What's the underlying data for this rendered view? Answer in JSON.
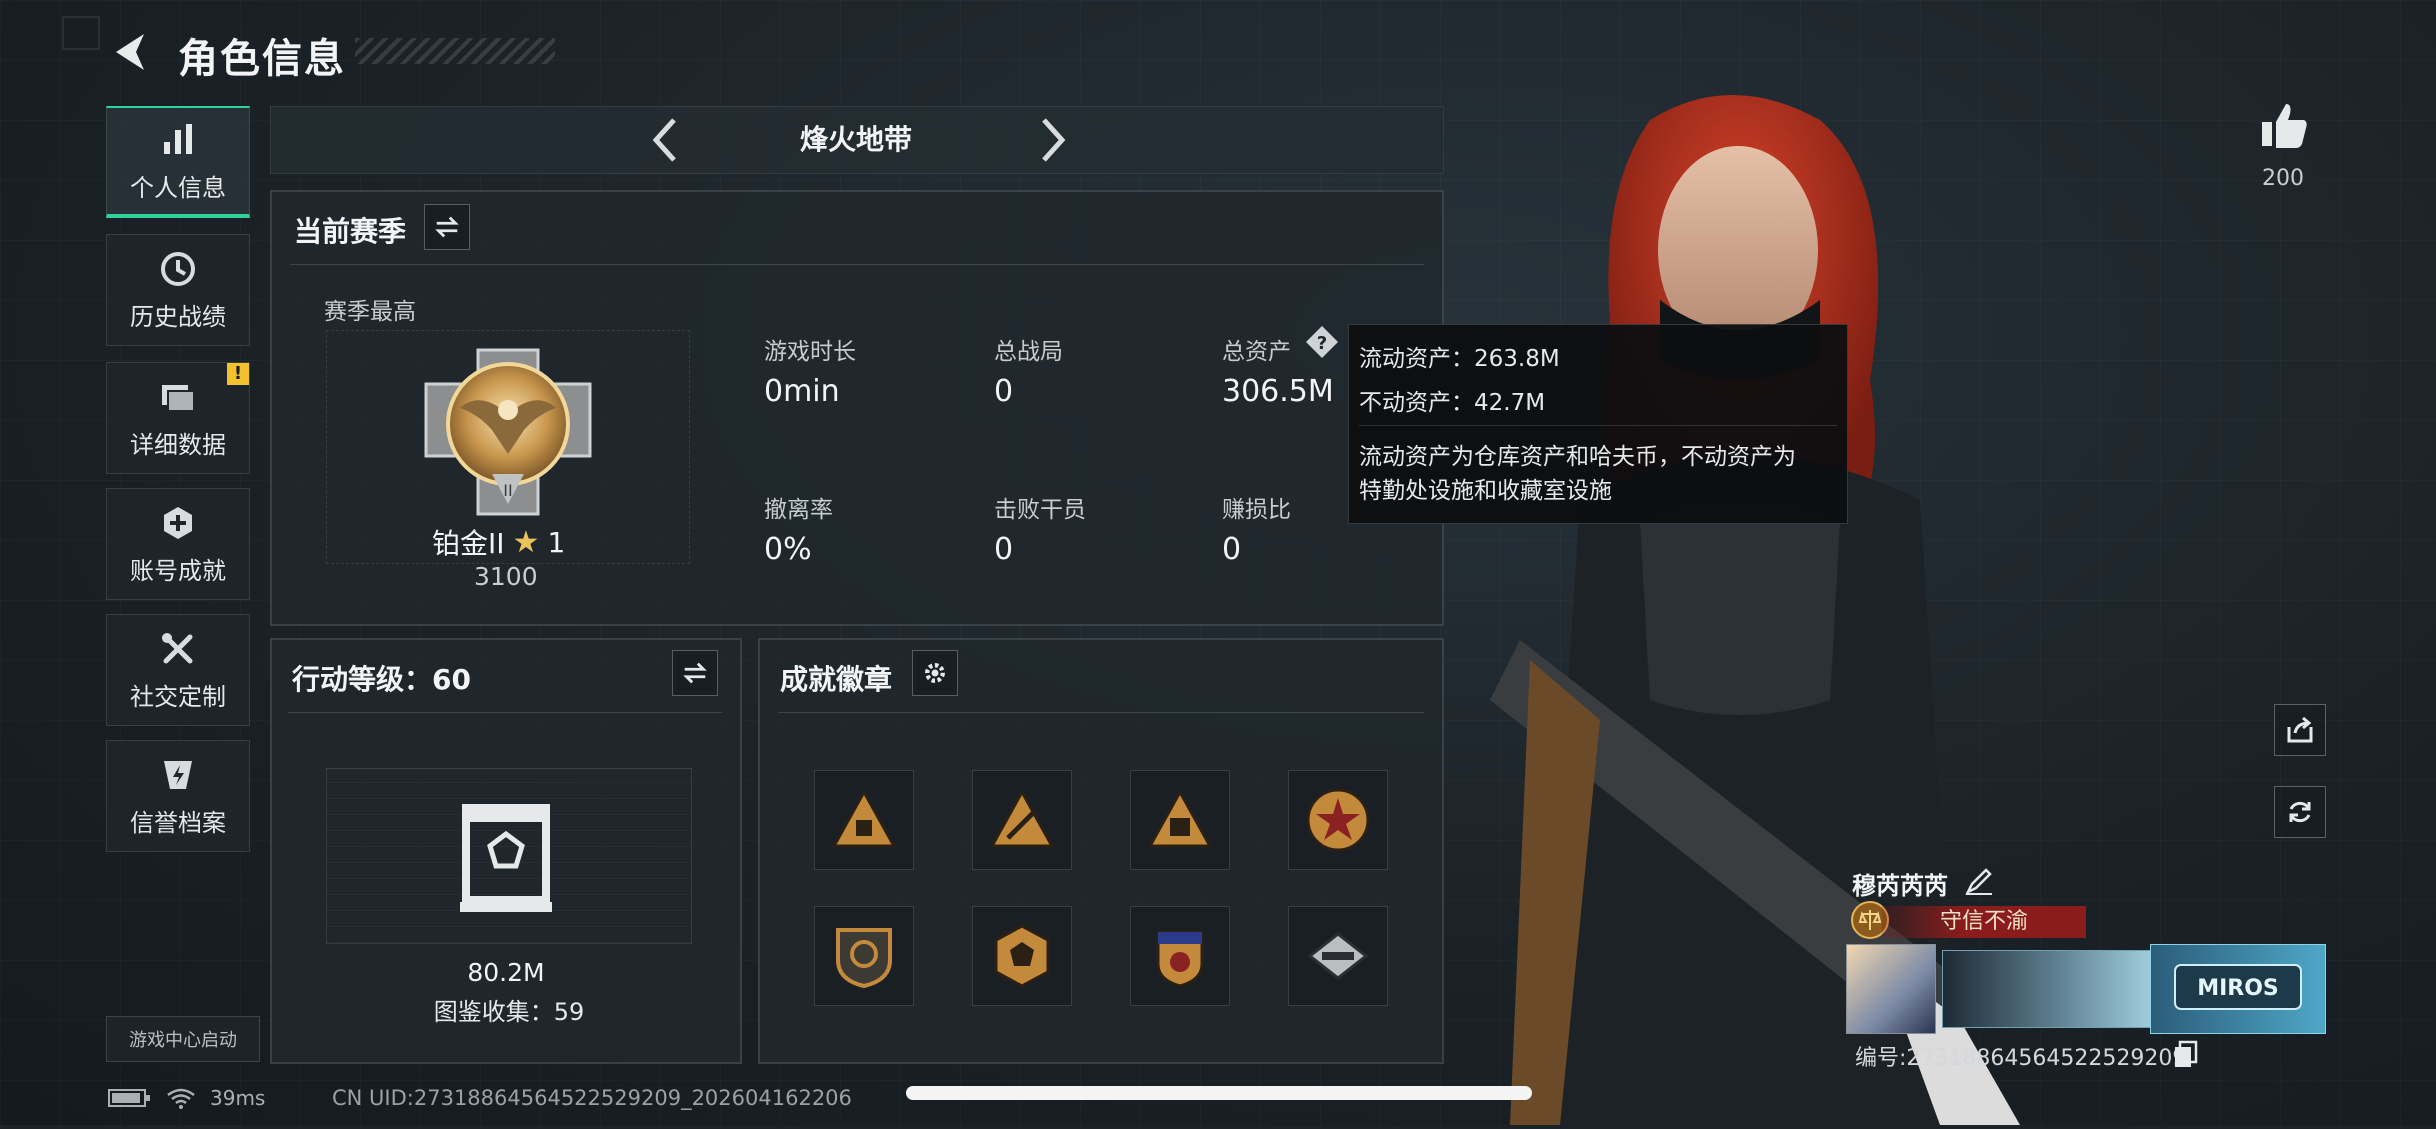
{
  "header": {
    "title": "角色信息"
  },
  "sidebar": {
    "items": [
      {
        "label": "个人信息",
        "icon": "bar-chart-icon",
        "active": true
      },
      {
        "label": "历史战绩",
        "icon": "history-clock-icon"
      },
      {
        "label": "详细数据",
        "icon": "folder-icon",
        "alert": "!"
      },
      {
        "label": "账号成就",
        "icon": "medal-icon"
      },
      {
        "label": "社交定制",
        "icon": "tools-icon"
      },
      {
        "label": "信誉档案",
        "icon": "shield-bolt-icon"
      }
    ],
    "game_center": "游戏中心启动"
  },
  "mode": {
    "title": "烽火地带"
  },
  "season": {
    "title": "当前赛季",
    "best_label": "赛季最高",
    "rank_name": "铂金II",
    "rank_stars": "1",
    "rank_points": "3100",
    "stats": [
      {
        "label": "游戏时长",
        "value": "0min"
      },
      {
        "label": "总战局",
        "value": "0"
      },
      {
        "label": "总资产",
        "value": "306.5M",
        "help": "?"
      },
      {
        "label": "撤离率",
        "value": "0%"
      },
      {
        "label": "击败干员",
        "value": "0"
      },
      {
        "label": "赚损比",
        "value": "0"
      }
    ]
  },
  "tooltip": {
    "liquid": "流动资产：263.8M",
    "fixed": "不动资产：42.7M",
    "note_line1": "流动资产为仓库资产和哈夫币，不动资产为",
    "note_line2": "特勤处设施和收藏室设施"
  },
  "action_level": {
    "title": "行动等级：60",
    "value": "80.2M",
    "collection": "图鉴收集：59"
  },
  "achievements": {
    "title": "成就徽章",
    "badges": [
      "badge-1",
      "badge-2",
      "badge-3",
      "badge-4",
      "badge-5",
      "badge-6",
      "badge-7",
      "badge-8"
    ]
  },
  "profile": {
    "likes": "200",
    "player_name": "穆芮芮芮",
    "honor": "守信不渝",
    "uid": "编号:2731886456452252920​9",
    "uid_display": "编号:27318864564522529209"
  },
  "status": {
    "ping": "39ms",
    "uid_line": "CN UID:27318864564522529209_202604162206"
  },
  "colors": {
    "accent": "#2fd39a",
    "alert": "#f2c22e",
    "honor_red": "#8b1c1c"
  }
}
